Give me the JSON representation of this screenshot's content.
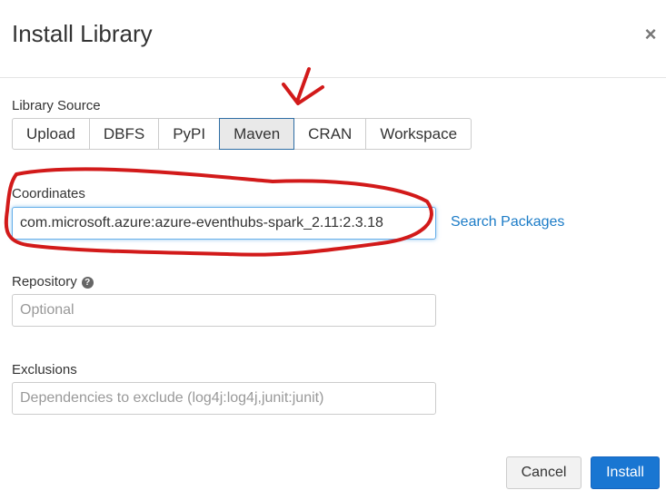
{
  "dialog": {
    "title": "Install Library",
    "close_glyph": "×"
  },
  "library_source": {
    "label": "Library Source",
    "tabs": [
      {
        "label": "Upload",
        "active": false
      },
      {
        "label": "DBFS",
        "active": false
      },
      {
        "label": "PyPI",
        "active": false
      },
      {
        "label": "Maven",
        "active": true
      },
      {
        "label": "CRAN",
        "active": false
      },
      {
        "label": "Workspace",
        "active": false
      }
    ]
  },
  "coordinates": {
    "label": "Coordinates",
    "value": "com.microsoft.azure:azure-eventhubs-spark_2.11:2.3.18",
    "search_link": "Search Packages"
  },
  "repository": {
    "label": "Repository",
    "help_glyph": "?",
    "value": "",
    "placeholder": "Optional"
  },
  "exclusions": {
    "label": "Exclusions",
    "value": "",
    "placeholder": "Dependencies to exclude (log4j:log4j,junit:junit)"
  },
  "footer": {
    "cancel_label": "Cancel",
    "install_label": "Install"
  },
  "colors": {
    "primary": "#1976d2",
    "link": "#1c7cc7",
    "annotation": "#d21a1a"
  },
  "icons": [
    "close-icon",
    "help-icon"
  ]
}
